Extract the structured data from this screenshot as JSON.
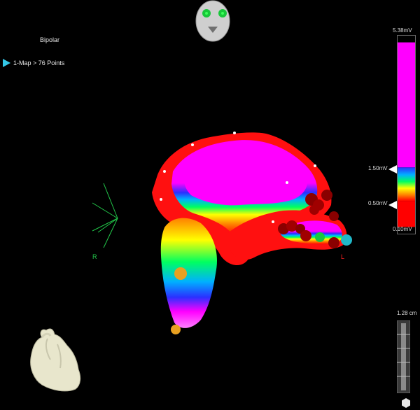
{
  "map": {
    "mode": "Bipolar",
    "item_label": "1-Map > 76 Points"
  },
  "voltage_scale": {
    "max": "5.38mV",
    "high": "1.50mV",
    "low": "0.50mV",
    "min": "0.10mV",
    "colors": [
      "#ff00ff",
      "#2030ff",
      "#00a0ff",
      "#00ff60",
      "#ffff00",
      "#ff8000",
      "#ff0000"
    ]
  },
  "orientation": {
    "right": "R",
    "left": "L"
  },
  "distance_scale": {
    "label": "1.28 cm"
  },
  "icons": {
    "face": "patient-face-icon",
    "heart": "heart-thumbnail-icon",
    "hex": "hexagon-icon",
    "pointer": "triangle-pointer-icon"
  }
}
